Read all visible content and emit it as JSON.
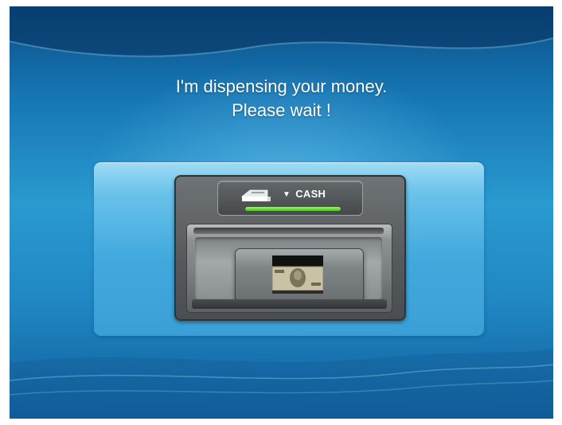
{
  "screen": {
    "message_line1": "I'm dispensing your money.",
    "message_line2": "Please wait !"
  },
  "dispenser": {
    "label": "CASH",
    "arrow_icon": "triangle-down-icon",
    "cash_icon": "cash-tray-icon",
    "progress_fraction": 1.0,
    "progress_color": "#4cc625"
  },
  "colors": {
    "background_dark": "#0c4f86",
    "background_light": "#2a9ad0",
    "panel": "#69c2ea",
    "device": "#55595c",
    "text": "#ffffff"
  }
}
